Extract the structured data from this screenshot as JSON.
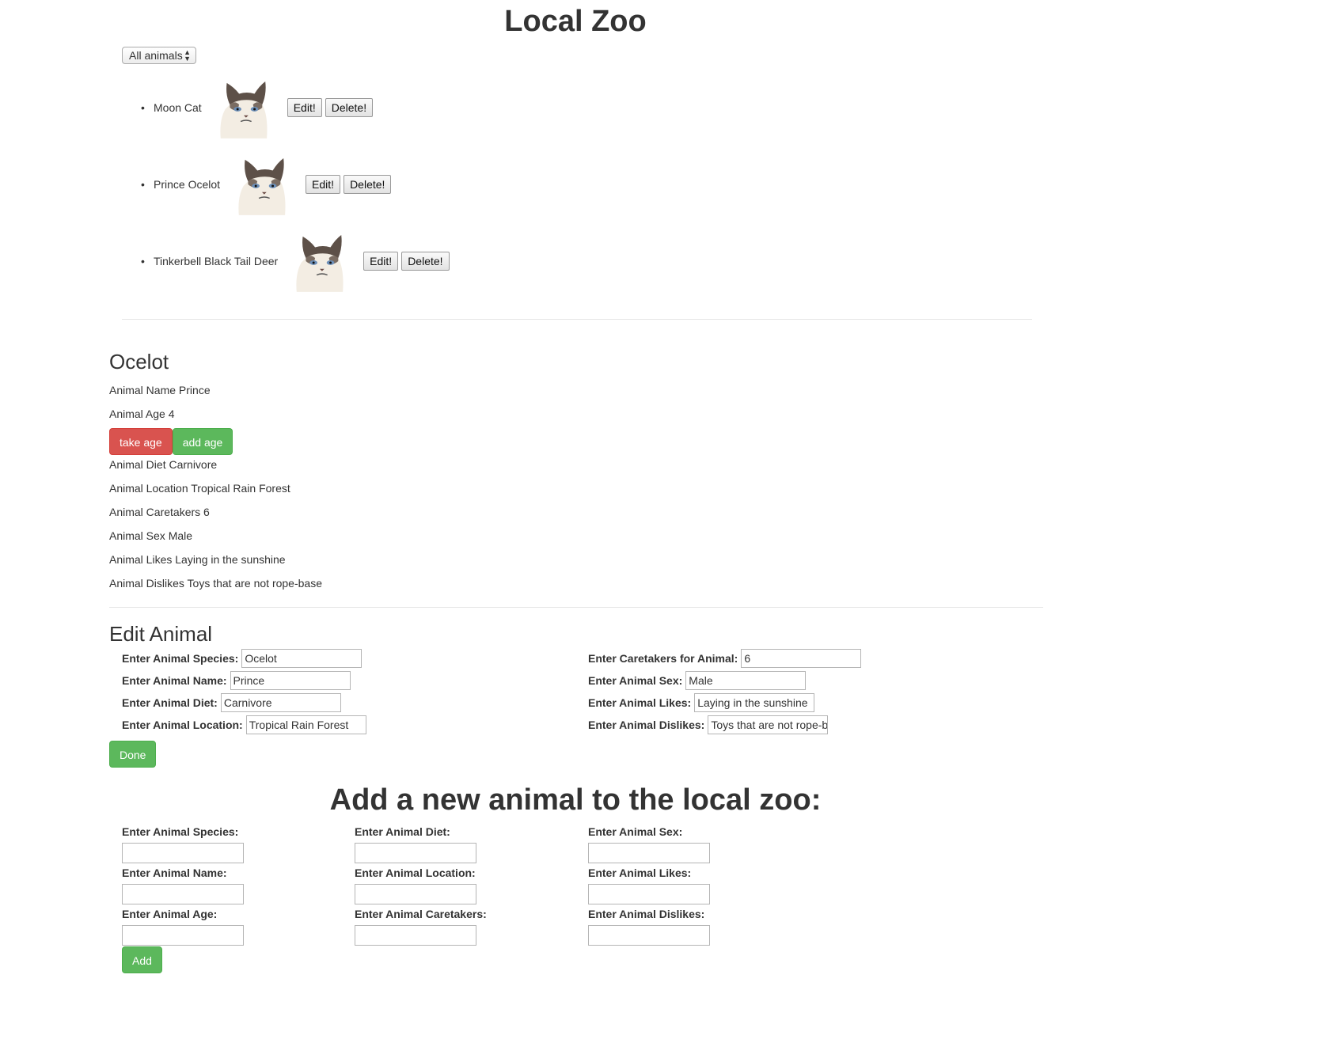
{
  "page": {
    "title": "Local Zoo"
  },
  "filter": {
    "selected": "All animals"
  },
  "animals": [
    {
      "name": "Moon Cat",
      "edit_label": "Edit!",
      "delete_label": "Delete!"
    },
    {
      "name": "Prince Ocelot",
      "edit_label": "Edit!",
      "delete_label": "Delete!"
    },
    {
      "name": "Tinkerbell Black Tail Deer",
      "edit_label": "Edit!",
      "delete_label": "Delete!"
    }
  ],
  "detail": {
    "species": "Ocelot",
    "name_line": "Animal Name Prince",
    "age_line": "Animal Age 4",
    "take_age_label": "take age",
    "add_age_label": "add age",
    "diet_line": "Animal Diet Carnivore",
    "location_line": "Animal Location Tropical Rain Forest",
    "caretakers_line": "Animal Caretakers 6",
    "sex_line": "Animal Sex Male",
    "likes_line": "Animal Likes Laying in the sunshine",
    "dislikes_line": "Animal Dislikes Toys that are not rope-base"
  },
  "edit_form": {
    "title": "Edit Animal",
    "species_label": "Enter Animal Species:",
    "species_value": "Ocelot",
    "name_label": "Enter Animal Name:",
    "name_value": "Prince",
    "diet_label": "Enter Animal Diet:",
    "diet_value": "Carnivore",
    "location_label": "Enter Animal Location:",
    "location_value": "Tropical Rain Forest",
    "caretakers_label": "Enter Caretakers for Animal:",
    "caretakers_value": "6",
    "sex_label": "Enter Animal Sex:",
    "sex_value": "Male",
    "likes_label": "Enter Animal Likes:",
    "likes_value": "Laying in the sunshine",
    "dislikes_label": "Enter Animal Dislikes:",
    "dislikes_value": "Toys that are not rope-b",
    "done_label": "Done"
  },
  "add_form": {
    "title": "Add a new animal to the local zoo:",
    "species_label": "Enter Animal Species:",
    "name_label": "Enter Animal Name:",
    "age_label": "Enter Animal Age:",
    "diet_label": "Enter Animal Diet:",
    "location_label": "Enter Animal Location:",
    "caretakers_label": "Enter Animal Caretakers:",
    "sex_label": "Enter Animal Sex:",
    "likes_label": "Enter Animal Likes:",
    "dislikes_label": "Enter Animal Dislikes:",
    "add_label": "Add"
  },
  "colors": {
    "danger": "#d9534f",
    "success": "#5cb85c",
    "text": "#333333"
  }
}
